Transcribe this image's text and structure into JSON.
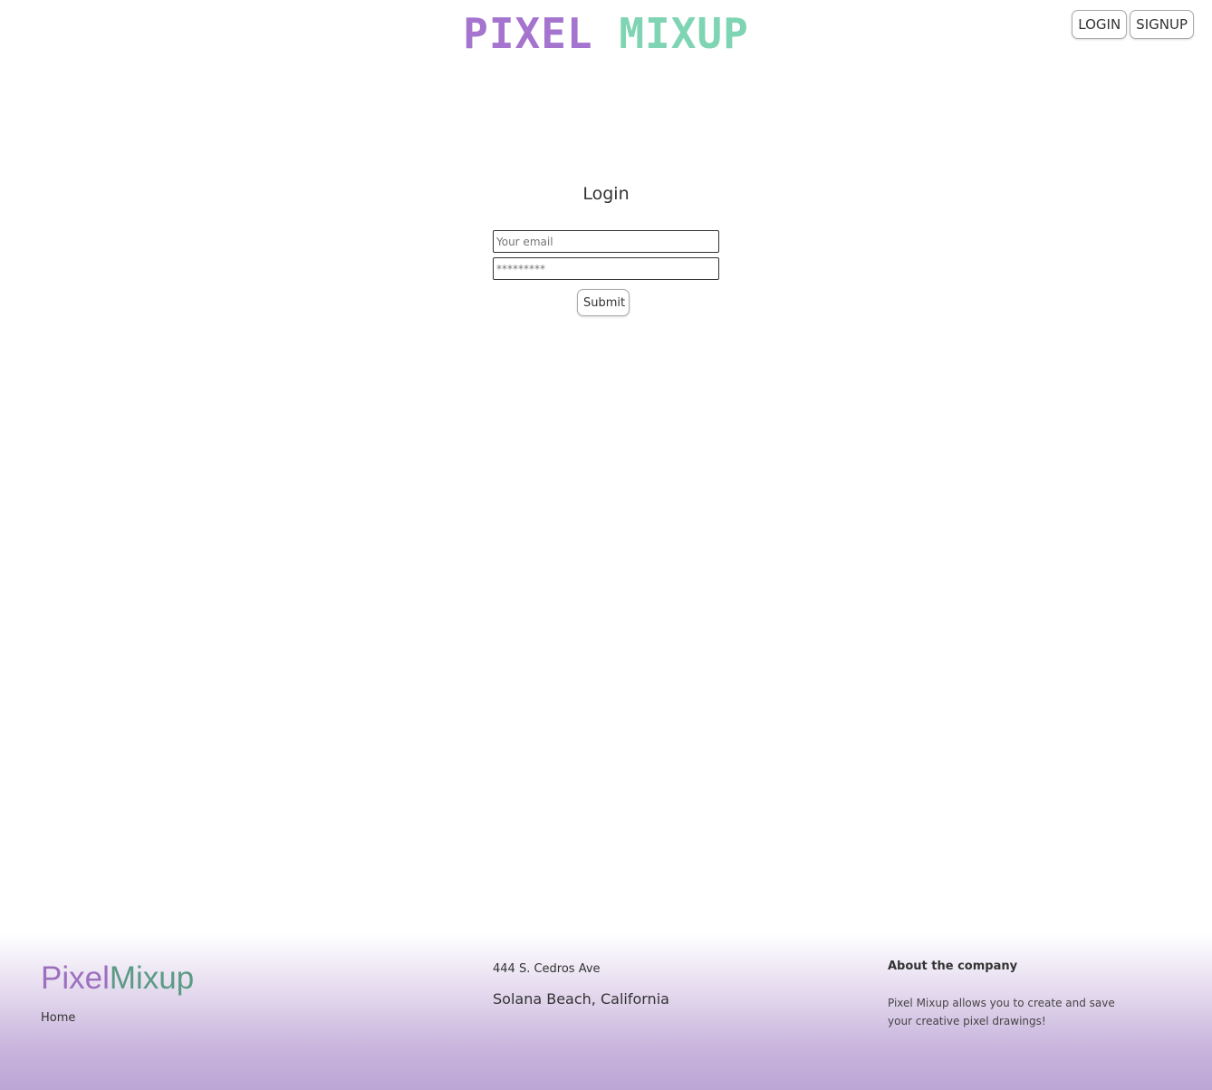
{
  "header": {
    "logo_part1": "PIXEL",
    "logo_part2": "MIXUP",
    "login_label": "LOGIN",
    "signup_label": "SIGNUP"
  },
  "login": {
    "title": "Login",
    "email_placeholder": "Your email",
    "password_value": "*********",
    "submit_label": "Submit"
  },
  "footer": {
    "brand_part1": "Pixel",
    "brand_part2": "Mixup",
    "home_link": "Home",
    "address_line1": "444 S. Cedros Ave",
    "address_line2": "Solana Beach, California",
    "about_title": "About the company",
    "about_text": "Pixel Mixup allows you to create and save your creative pixel drawings!"
  },
  "colors": {
    "logo_purple": "#a574cf",
    "logo_green": "#7fd4b3",
    "footer_gradient_bottom": "#bca6d6"
  }
}
